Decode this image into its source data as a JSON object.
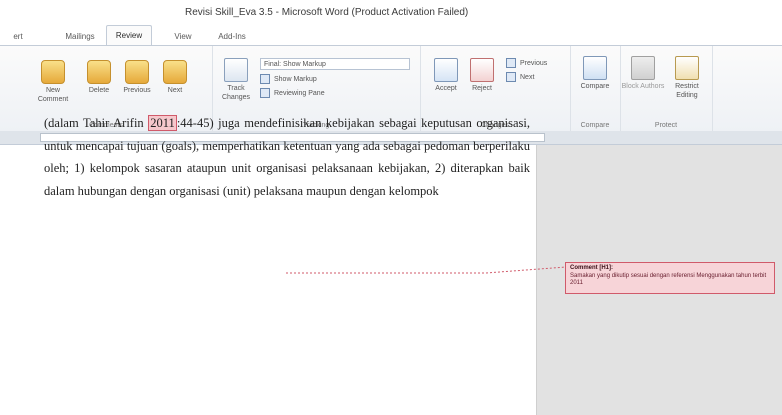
{
  "window": {
    "title": "Revisi Skill_Eva 3.5 - Microsoft Word (Product Activation Failed)"
  },
  "tabs": [
    {
      "label": "ert",
      "active": false
    },
    {
      "label": "Mailings",
      "active": false
    },
    {
      "label": "Review",
      "active": true
    },
    {
      "label": "View",
      "active": false
    },
    {
      "label": "Add-Ins",
      "active": false
    }
  ],
  "ribbon": {
    "comments": {
      "group_label": "Comments",
      "buttons": [
        "New Comment",
        "Delete",
        "Previous",
        "Next"
      ]
    },
    "tracking": {
      "group_label": "Tracking",
      "track_changes": "Track Changes",
      "display_mode": "Final: Show Markup",
      "show_markup": "Show Markup",
      "reviewing_pane": "Reviewing Pane"
    },
    "changes": {
      "group_label": "Changes",
      "buttons": [
        "Accept",
        "Reject"
      ],
      "previous": "Previous",
      "next": "Next"
    },
    "compare": {
      "group_label": "Compare",
      "button": "Compare"
    },
    "protect": {
      "group_label": "Protect",
      "buttons": [
        "Block Authors",
        "Restrict Editing"
      ]
    }
  },
  "document": {
    "before_citation": "(dalam Tahir Arifin",
    "citation": "2011",
    "after_citation": ":44-45) juga mendefinisikan kebijakan sebagai keputusan organisasi, untuk mencapai tujuan (goals), memperhatikan ketentuan yang ada sebagai pedoman berperilaku oleh; 1) kelompok sasaran ataupun unit organisasi pelaksanaan kebijakan, 2) diterapkan baik dalam hubungan dengan organisasi (unit) pelaksana maupun dengan kelompok"
  },
  "comment": {
    "title": "Comment [H1]:",
    "body": "Samakan yang dikutip sesuai dengan referensi Menggunakan tahun terbit 2011"
  },
  "colors": {
    "comment_fill": "#f7d4d8",
    "comment_border": "#d05a6a",
    "active_tab": "#fbfbfb",
    "markup_pane": "#e2e2e2"
  }
}
